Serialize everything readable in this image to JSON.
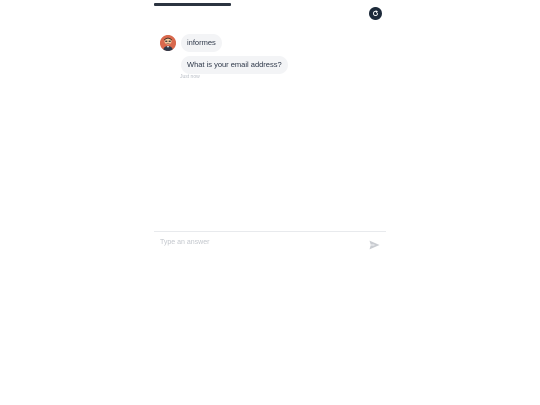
{
  "header": {
    "progress": 0.33,
    "progress_color": "#2b3440",
    "restart_icon": "refresh-icon",
    "restart_button_color": "#1d2a3a"
  },
  "conversation": {
    "bot_avatar": "bot-avatar",
    "messages": [
      {
        "text": "informes"
      },
      {
        "text": "What is your email address?"
      }
    ],
    "timestamp": "Just now"
  },
  "composer": {
    "placeholder": "Type an answer",
    "send_icon": "send-icon"
  }
}
